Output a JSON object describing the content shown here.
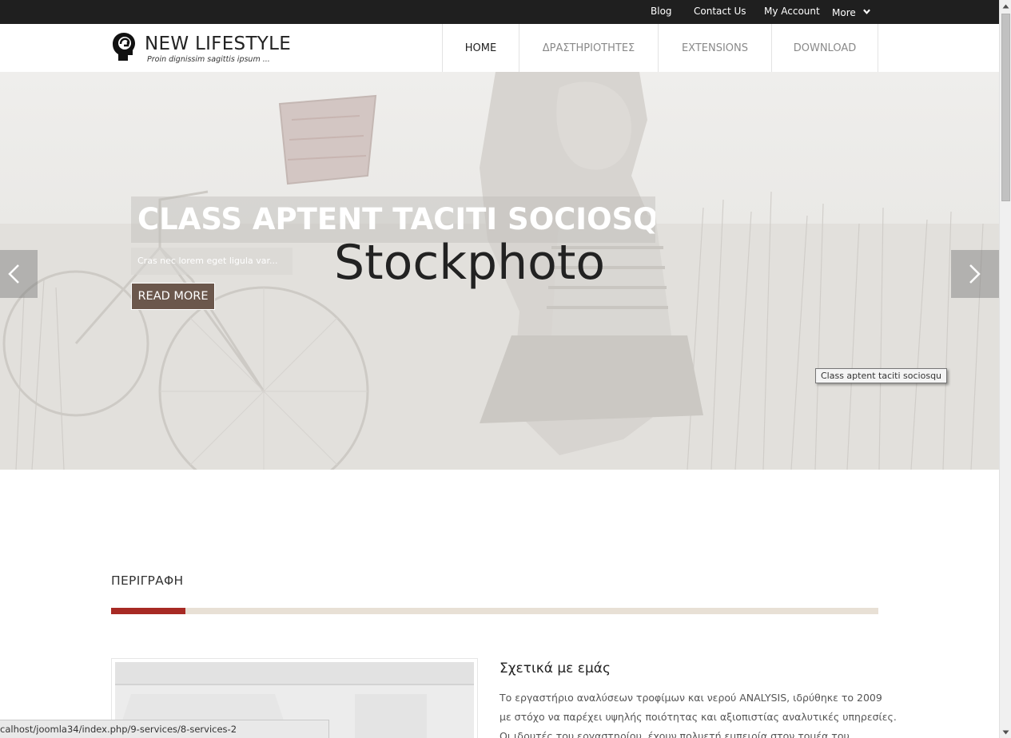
{
  "topbar": {
    "links": [
      "Blog",
      "Contact Us",
      "My Account",
      "More"
    ],
    "more_icon": "chevron-down-icon"
  },
  "header": {
    "logo_icon": "head-silhouette-icon",
    "title": "NEW LIFESTYLE",
    "tagline": "Proin dignissim sagittis ipsum ..."
  },
  "nav": {
    "items": [
      "HOME",
      "ΔΡΑΣΤΗΡΙΟΤΗΤΕΣ",
      "EXTENSIONS",
      "DOWNLOAD"
    ],
    "active": "HOME"
  },
  "slider": {
    "title": "CLASS APTENT TACITI SOCIOSQU",
    "subtitle": "Cras nec lorem eget ligula var...",
    "button": "READ MORE",
    "watermark": "Stockphoto",
    "prev_icon": "chevron-left-icon",
    "next_icon": "chevron-right-icon",
    "tooltip": "Class aptent taciti sociosqu"
  },
  "section": {
    "title": "ΠΕΡΙΓΡΑΦΗ",
    "accent_color": "#a72a24",
    "divider_color": "#e8e0d5"
  },
  "about": {
    "title": "Σχετικά με εμάς",
    "lines": [
      "Το εργαστήριο αναλύσεων τροφίμων και νερού ANALYSIS, ιδρύθηκε το 2009",
      "με στόχο να παρέχει υψηλής ποιότητας και αξιοπιστίας αναλυτικές υπηρεσίες.",
      "Οι ιδρυτές του εργαστηρίου, έχουν πολυετή εμπειρία στον τομέα του"
    ]
  },
  "status_url": "calhost/joomla34/index.php/9-services/8-services-2",
  "colors": {
    "topbar_bg": "#1f1f1f",
    "button_bg": "#6b574c"
  }
}
